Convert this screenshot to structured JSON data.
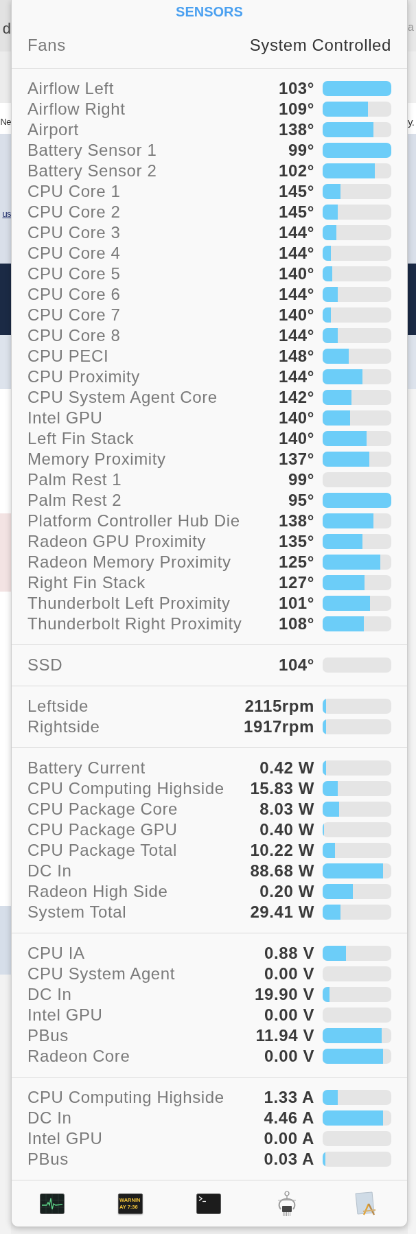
{
  "background_page": {
    "left_edge": [
      {
        "text": "d",
        "kind": "plain"
      },
      {
        "text": "Ne",
        "kind": "plain"
      },
      {
        "text": "us",
        "kind": "link"
      }
    ],
    "right_edge": [
      {
        "text": "a",
        "kind": "faint"
      },
      {
        "text": "y.",
        "kind": "plain"
      }
    ]
  },
  "popup": {
    "title": "SENSORS",
    "fans": {
      "label": "Fans",
      "value": "System Controlled"
    },
    "sections": [
      {
        "rows": [
          {
            "name": "Airflow Left",
            "reading": "103°",
            "level": 1.0
          },
          {
            "name": "Airflow Right",
            "reading": "109°",
            "level": 0.66
          },
          {
            "name": "Airport",
            "reading": "138°",
            "level": 0.74
          },
          {
            "name": "Battery Sensor 1",
            "reading": "99°",
            "level": 1.0
          },
          {
            "name": "Battery Sensor 2",
            "reading": "102°",
            "level": 0.76
          },
          {
            "name": "CPU Core 1",
            "reading": "145°",
            "level": 0.26
          },
          {
            "name": "CPU Core 2",
            "reading": "145°",
            "level": 0.22
          },
          {
            "name": "CPU Core 3",
            "reading": "144°",
            "level": 0.2
          },
          {
            "name": "CPU Core 4",
            "reading": "144°",
            "level": 0.12
          },
          {
            "name": "CPU Core 5",
            "reading": "140°",
            "level": 0.14
          },
          {
            "name": "CPU Core 6",
            "reading": "144°",
            "level": 0.22
          },
          {
            "name": "CPU Core 7",
            "reading": "140°",
            "level": 0.12
          },
          {
            "name": "CPU Core 8",
            "reading": "144°",
            "level": 0.22
          },
          {
            "name": "CPU PECI",
            "reading": "148°",
            "level": 0.38
          },
          {
            "name": "CPU Proximity",
            "reading": "144°",
            "level": 0.58
          },
          {
            "name": "CPU System Agent Core",
            "reading": "142°",
            "level": 0.42
          },
          {
            "name": "Intel GPU",
            "reading": "140°",
            "level": 0.4
          },
          {
            "name": "Left Fin Stack",
            "reading": "140°",
            "level": 0.64
          },
          {
            "name": "Memory Proximity",
            "reading": "137°",
            "level": 0.68
          },
          {
            "name": "Palm Rest 1",
            "reading": "99°",
            "level": 0
          },
          {
            "name": "Palm Rest 2",
            "reading": "95°",
            "level": 1.0
          },
          {
            "name": "Platform Controller Hub Die",
            "reading": "138°",
            "level": 0.74
          },
          {
            "name": "Radeon GPU Proximity",
            "reading": "135°",
            "level": 0.58
          },
          {
            "name": "Radeon Memory Proximity",
            "reading": "125°",
            "level": 0.84
          },
          {
            "name": "Right Fin Stack",
            "reading": "127°",
            "level": 0.61
          },
          {
            "name": "Thunderbolt Left Proximity",
            "reading": "101°",
            "level": 0.69
          },
          {
            "name": "Thunderbolt Right Proximity",
            "reading": "108°",
            "level": 0.6
          }
        ]
      },
      {
        "rows": [
          {
            "name": "SSD",
            "reading": "104°",
            "level": 0
          }
        ]
      },
      {
        "rows": [
          {
            "name": "Leftside",
            "reading": "2115rpm",
            "level": 0.05
          },
          {
            "name": "Rightside",
            "reading": "1917rpm",
            "level": 0.05
          }
        ]
      },
      {
        "rows": [
          {
            "name": "Battery Current",
            "reading": "0.42 W",
            "level": 0.05
          },
          {
            "name": "CPU Computing Highside",
            "reading": "15.83 W",
            "level": 0.22
          },
          {
            "name": "CPU Package Core",
            "reading": "8.03 W",
            "level": 0.24
          },
          {
            "name": "CPU Package GPU",
            "reading": "0.40 W",
            "level": 0.02
          },
          {
            "name": "CPU Package Total",
            "reading": "10.22 W",
            "level": 0.18
          },
          {
            "name": "DC In",
            "reading": "88.68 W",
            "level": 0.88
          },
          {
            "name": "Radeon High Side",
            "reading": "0.20 W",
            "level": 0.44
          },
          {
            "name": "System Total",
            "reading": "29.41 W",
            "level": 0.26
          }
        ]
      },
      {
        "rows": [
          {
            "name": "CPU IA",
            "reading": "0.88 V",
            "level": 0.34
          },
          {
            "name": "CPU System Agent",
            "reading": "0.00 V",
            "level": 0
          },
          {
            "name": "DC In",
            "reading": "19.90 V",
            "level": 0.1
          },
          {
            "name": "Intel GPU",
            "reading": "0.00 V",
            "level": 0
          },
          {
            "name": "PBus",
            "reading": "11.94 V",
            "level": 0.86
          },
          {
            "name": "Radeon Core",
            "reading": "0.00 V",
            "level": 0.88
          }
        ]
      },
      {
        "rows": [
          {
            "name": "CPU Computing Highside",
            "reading": "1.33 A",
            "level": 0.22
          },
          {
            "name": "DC In",
            "reading": "4.46 A",
            "level": 0.88
          },
          {
            "name": "Intel GPU",
            "reading": "0.00 A",
            "level": 0
          },
          {
            "name": "PBus",
            "reading": "0.03 A",
            "level": 0.04
          }
        ]
      }
    ],
    "toolbar": [
      {
        "kind": "heartbeat"
      },
      {
        "kind": "console",
        "lines": [
          "WARNIN",
          "AY 7:36"
        ]
      },
      {
        "kind": "terminal"
      },
      {
        "kind": "chip"
      },
      {
        "kind": "blueprint"
      }
    ]
  }
}
